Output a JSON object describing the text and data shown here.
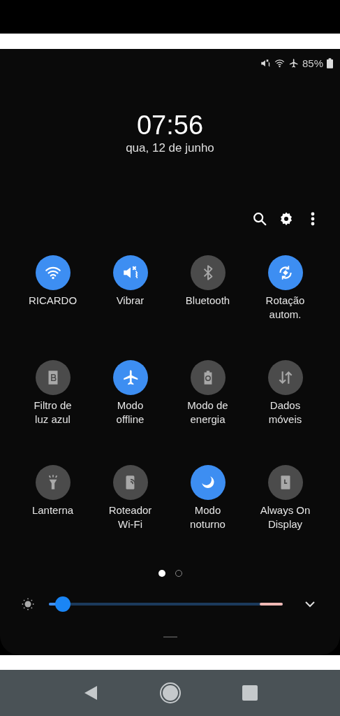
{
  "status_bar": {
    "battery": "85%"
  },
  "clock": {
    "time": "07:56",
    "date": "qua, 12 de junho"
  },
  "tiles": [
    {
      "label": "RICARDO",
      "on": true
    },
    {
      "label": "Vibrar",
      "on": true
    },
    {
      "label": "Bluetooth",
      "on": false
    },
    {
      "label": "Rotação\nautom.",
      "on": true
    },
    {
      "label": "Filtro de\nluz azul",
      "on": false
    },
    {
      "label": "Modo\noffline",
      "on": true
    },
    {
      "label": "Modo de\nenergia",
      "on": false
    },
    {
      "label": "Dados\nmóveis",
      "on": false
    },
    {
      "label": "Lanterna",
      "on": false
    },
    {
      "label": "Roteador\nWi-Fi",
      "on": false
    },
    {
      "label": "Modo\nnoturno",
      "on": true
    },
    {
      "label": "Always On\nDisplay",
      "on": false
    }
  ],
  "page_dots": [
    {
      "selected": true
    },
    {
      "selected": false
    }
  ],
  "brightness": {
    "level": 0.06
  }
}
